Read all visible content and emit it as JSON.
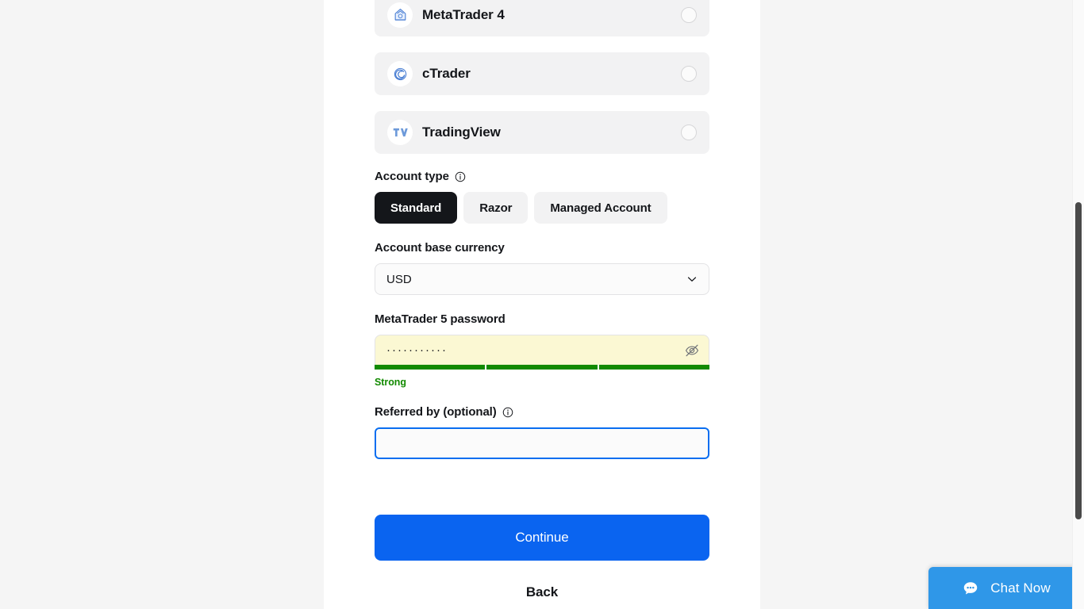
{
  "platforms": [
    {
      "label": "MetaTrader 4",
      "icon": "metatrader4-icon",
      "selected": false
    },
    {
      "label": "cTrader",
      "icon": "ctrader-icon",
      "selected": false
    },
    {
      "label": "TradingView",
      "icon": "tradingview-icon",
      "selected": false
    }
  ],
  "account_type": {
    "label": "Account type",
    "info_icon": "info-icon",
    "options": [
      {
        "label": "Standard",
        "active": true
      },
      {
        "label": "Razor",
        "active": false
      },
      {
        "label": "Managed Account",
        "active": false
      }
    ]
  },
  "base_currency": {
    "label": "Account base currency",
    "value": "USD",
    "chevron_icon": "chevron-down-icon"
  },
  "password": {
    "label": "MetaTrader 5 password",
    "value": "···········",
    "masked_char_count": 11,
    "toggle_icon": "eye-off-icon",
    "strength_text": "Strong",
    "strength_segments": 3,
    "strength_filled": 3,
    "strength_color": "#128a00",
    "field_background": "#fbf8d3"
  },
  "referral": {
    "label": "Referred by (optional)",
    "info_icon": "info-icon",
    "value": "",
    "placeholder": "",
    "focused": true,
    "focus_color": "#0a6ef0"
  },
  "actions": {
    "continue_label": "Continue",
    "continue_color": "#0a64f0",
    "back_label": "Back"
  },
  "chat_widget": {
    "label": "Chat Now",
    "icon": "chat-bubble-icon",
    "color": "#2f97e8"
  }
}
